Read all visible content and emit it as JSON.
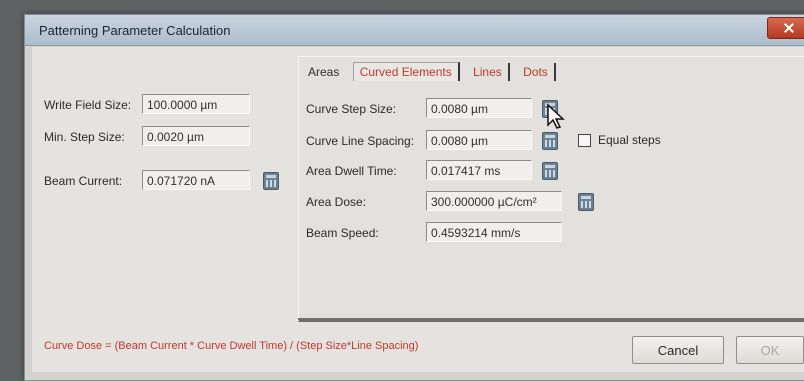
{
  "window": {
    "title": "Patterning Parameter Calculation"
  },
  "left": {
    "write_field_label": "Write Field Size:",
    "write_field_value": "100.0000 µm",
    "min_step_label": "Min. Step Size:",
    "min_step_value": "0.0020 µm",
    "beam_current_label": "Beam Current:",
    "beam_current_value": "0.071720 nA"
  },
  "tabs": [
    {
      "label": "Areas"
    },
    {
      "label": "Curved Elements"
    },
    {
      "label": "Lines"
    },
    {
      "label": "Dots"
    }
  ],
  "curved": {
    "curve_step_label": "Curve Step Size:",
    "curve_step_value": "0.0080 µm",
    "curve_line_label": "Curve Line Spacing:",
    "curve_line_value": "0.0080 µm",
    "equal_steps_label": "Equal steps",
    "area_dwell_label": "Area Dwell Time:",
    "area_dwell_value": "0.017417 ms",
    "area_dose_label": "Area Dose:",
    "area_dose_value": "300.000000 µC/cm²",
    "beam_speed_label": "Beam Speed:",
    "beam_speed_value": "0.4593214 mm/s"
  },
  "footer": {
    "formula": "Curve Dose = (Beam Current * Curve Dwell Time) / (Step Size*Line Spacing)",
    "cancel_label": "Cancel",
    "ok_label": "OK"
  },
  "colors": {
    "accent_red": "#c0392b",
    "titlebar": "#b9c7d5"
  }
}
